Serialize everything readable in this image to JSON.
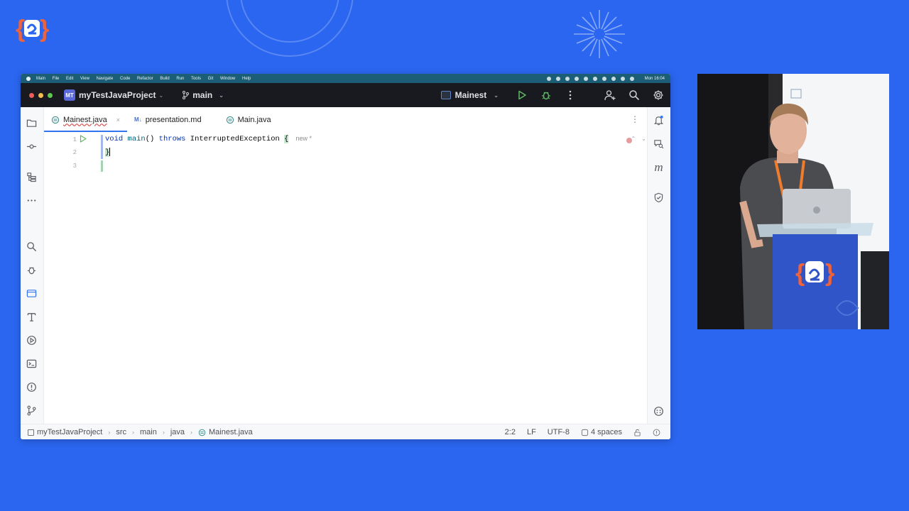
{
  "macmenu": {
    "items": [
      "Main",
      "File",
      "Edit",
      "View",
      "Navigate",
      "Code",
      "Refactor",
      "Build",
      "Run",
      "Tools",
      "Git",
      "Window",
      "Help"
    ],
    "clock": "Mon 16:04"
  },
  "titlebar": {
    "project_badge": "MT",
    "project_name": "myTestJavaProject",
    "branch": "main",
    "run_config": "Mainest"
  },
  "tabs": [
    {
      "label": "Mainest.java",
      "active": true
    },
    {
      "label": "presentation.md",
      "active": false,
      "prefix": "M↓"
    },
    {
      "label": "Main.java",
      "active": false
    }
  ],
  "editor": {
    "line_numbers": [
      "1",
      "2",
      "3"
    ],
    "line1": {
      "kw1": "void",
      "fn": "main",
      "paren": "()",
      "kw2": "throws",
      "type": "InterruptedException",
      "brace": "{",
      "inlay": "new *"
    },
    "line2": {
      "brace": "}"
    }
  },
  "right_strip": {
    "m_label": "m"
  },
  "statusbar": {
    "breadcrumb": [
      "myTestJavaProject",
      "src",
      "main",
      "java",
      "Mainest.java"
    ],
    "position": "2:2",
    "line_sep": "LF",
    "encoding": "UTF-8",
    "indent": "4 spaces"
  },
  "colors": {
    "background": "#2b66f0",
    "ide_titlebar": "#181a1f",
    "accent": "#3574f0",
    "logo_orange": "#f0623a"
  }
}
